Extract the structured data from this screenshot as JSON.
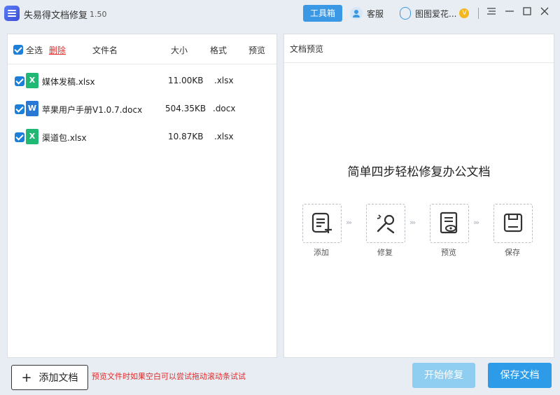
{
  "titlebar": {
    "app_title": "失易得文档修复",
    "version": "1.50",
    "toolbox_label": "工具箱",
    "support_label": "客服",
    "user_name": "图图爱花...",
    "vip_badge": "V"
  },
  "file_list": {
    "headers": {
      "select_all": "全选",
      "delete": "删除",
      "name": "文件名",
      "size": "大小",
      "format": "格式",
      "preview": "预览"
    },
    "rows": [
      {
        "checked": true,
        "icon": "excel-icon",
        "icon_letter": "X",
        "name": "媒体发稿.xlsx",
        "size": "11.00KB",
        "format": ".xlsx"
      },
      {
        "checked": true,
        "icon": "word-icon",
        "icon_letter": "W",
        "name": "苹果用户手册V1.0.7.docx",
        "size": "504.35KB",
        "format": ".docx"
      },
      {
        "checked": true,
        "icon": "excel-icon",
        "icon_letter": "X",
        "name": "渠道包.xlsx",
        "size": "10.87KB",
        "format": ".xlsx"
      }
    ]
  },
  "preview": {
    "title": "文档预览",
    "headline": "简单四步轻松修复办公文档",
    "steps": [
      {
        "label": "添加",
        "icon": "add-document-icon"
      },
      {
        "label": "修复",
        "icon": "repair-tools-icon"
      },
      {
        "label": "预览",
        "icon": "preview-document-icon"
      },
      {
        "label": "保存",
        "icon": "save-disk-icon"
      }
    ]
  },
  "footer": {
    "add_button": "添加文档",
    "hint": "预览文件时如果空白可以尝试拖动滚动条试试",
    "start_button": "开始修复",
    "save_button": "保存文档"
  },
  "colors": {
    "accent": "#2d9be7",
    "start_disabled": "#8fcdf1",
    "delete_red": "#e02b2b",
    "checkbox": "#1d7fd8",
    "excel_green": "#21b774",
    "word_blue": "#2a78d6"
  }
}
